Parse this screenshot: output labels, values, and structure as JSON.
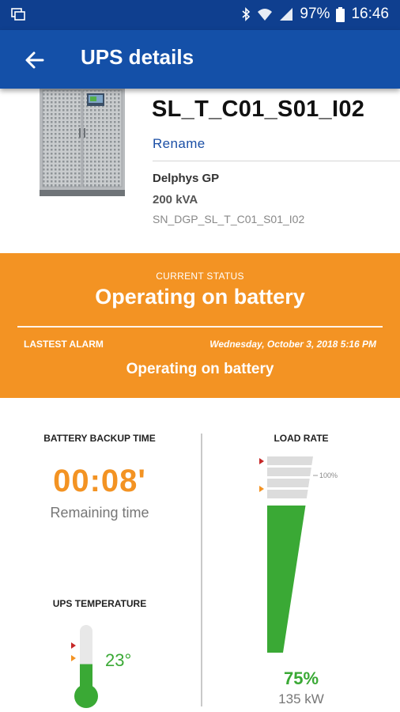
{
  "status_bar": {
    "battery_percent": "97%",
    "time": "16:46"
  },
  "app_bar": {
    "title": "UPS details",
    "back_icon": "arrow-back-icon"
  },
  "device": {
    "name": "SL_T_C01_S01_I02",
    "rename_label": "Rename",
    "model": "Delphys GP",
    "power": "200 kVA",
    "serial": "SN_DGP_SL_T_C01_S01_I02"
  },
  "current_status": {
    "label": "CURRENT STATUS",
    "value": "Operating on battery",
    "alarm_label": "LASTEST ALARM",
    "alarm_date": "Wednesday, October 3, 2018 5:16 PM",
    "alarm_value": "Operating on battery",
    "color": "#f39323"
  },
  "battery_backup": {
    "label": "BATTERY BACKUP TIME",
    "value": "00:08'",
    "sub": "Remaining time"
  },
  "temperature": {
    "label": "UPS TEMPERATURE",
    "value": "23°",
    "fill_fraction": 0.45
  },
  "load_rate": {
    "label": "LOAD RATE",
    "percent_text": "75%",
    "percent_value": 75,
    "kw": "135 kW",
    "marker_100_label": "100%",
    "color": "#3aa935"
  }
}
